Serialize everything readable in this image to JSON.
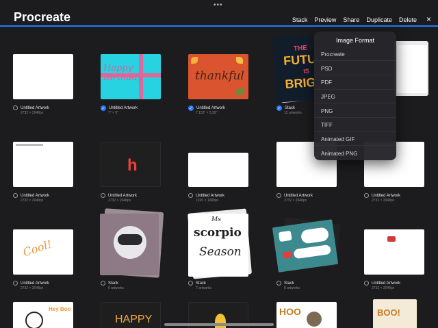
{
  "app": {
    "title": "Procreate"
  },
  "toolbar": {
    "stack": "Stack",
    "preview": "Preview",
    "share": "Share",
    "duplicate": "Duplicate",
    "delete": "Delete",
    "close_icon": "×"
  },
  "menu": {
    "title": "Image Format",
    "items": [
      "Procreate",
      "PSD",
      "PDF",
      "JPEG",
      "PNG",
      "TIFF",
      "Animated GIF",
      "Animated PNG"
    ]
  },
  "tiles": [
    {
      "name": "Untitled Artwork",
      "size": "2732 × 2048px",
      "selected": false
    },
    {
      "name": "Untitled Artwork",
      "size": "7\" × 5\"",
      "selected": true
    },
    {
      "name": "Untitled Artwork",
      "size": "7.153\" × 5.28\"",
      "selected": true
    },
    {
      "name": "Stack",
      "size": "12 artworks",
      "selected": true
    },
    {
      "name": "Untitled Artwork",
      "size": "2732 × 2048px",
      "selected": false
    },
    {
      "name": "Untitled Artwork",
      "size": "2732 × 2048px",
      "selected": false
    },
    {
      "name": "Untitled Artwork",
      "size": "1920 × 1080px",
      "selected": false
    },
    {
      "name": "Untitled Artwork",
      "size": "2732 × 2048px",
      "selected": false
    },
    {
      "name": "Untitled Artwork",
      "size": "2732 × 2048px",
      "selected": false
    },
    {
      "name": "Untitled Artwork",
      "size": "2732 × 2048px",
      "selected": false
    },
    {
      "name": "Stack",
      "size": "6 artworks",
      "selected": false
    },
    {
      "name": "Stack",
      "size": "7 artworks",
      "selected": false
    },
    {
      "name": "Stack",
      "size": "5 artworks",
      "selected": false
    },
    {
      "name": "Untitled Artwork",
      "size": "2732 × 2048px",
      "selected": false
    }
  ],
  "art_text": {
    "birthday": "Happy Birthday",
    "thankful": "thankful",
    "future_line1": "THE",
    "future_line2": "FUTU",
    "future_line3": "IS",
    "future_line4": "BRIG",
    "h_letter": "h",
    "scorpio_line1": "Ms",
    "scorpio_line2": "scorpio",
    "scorpio_line3": "Season",
    "cool": "Cool!",
    "happy": "HAPPY",
    "hoo": "HOO",
    "boo": "BOO!"
  },
  "colors": {
    "accent": "#1f7bff",
    "background": "#1c1c1e"
  }
}
